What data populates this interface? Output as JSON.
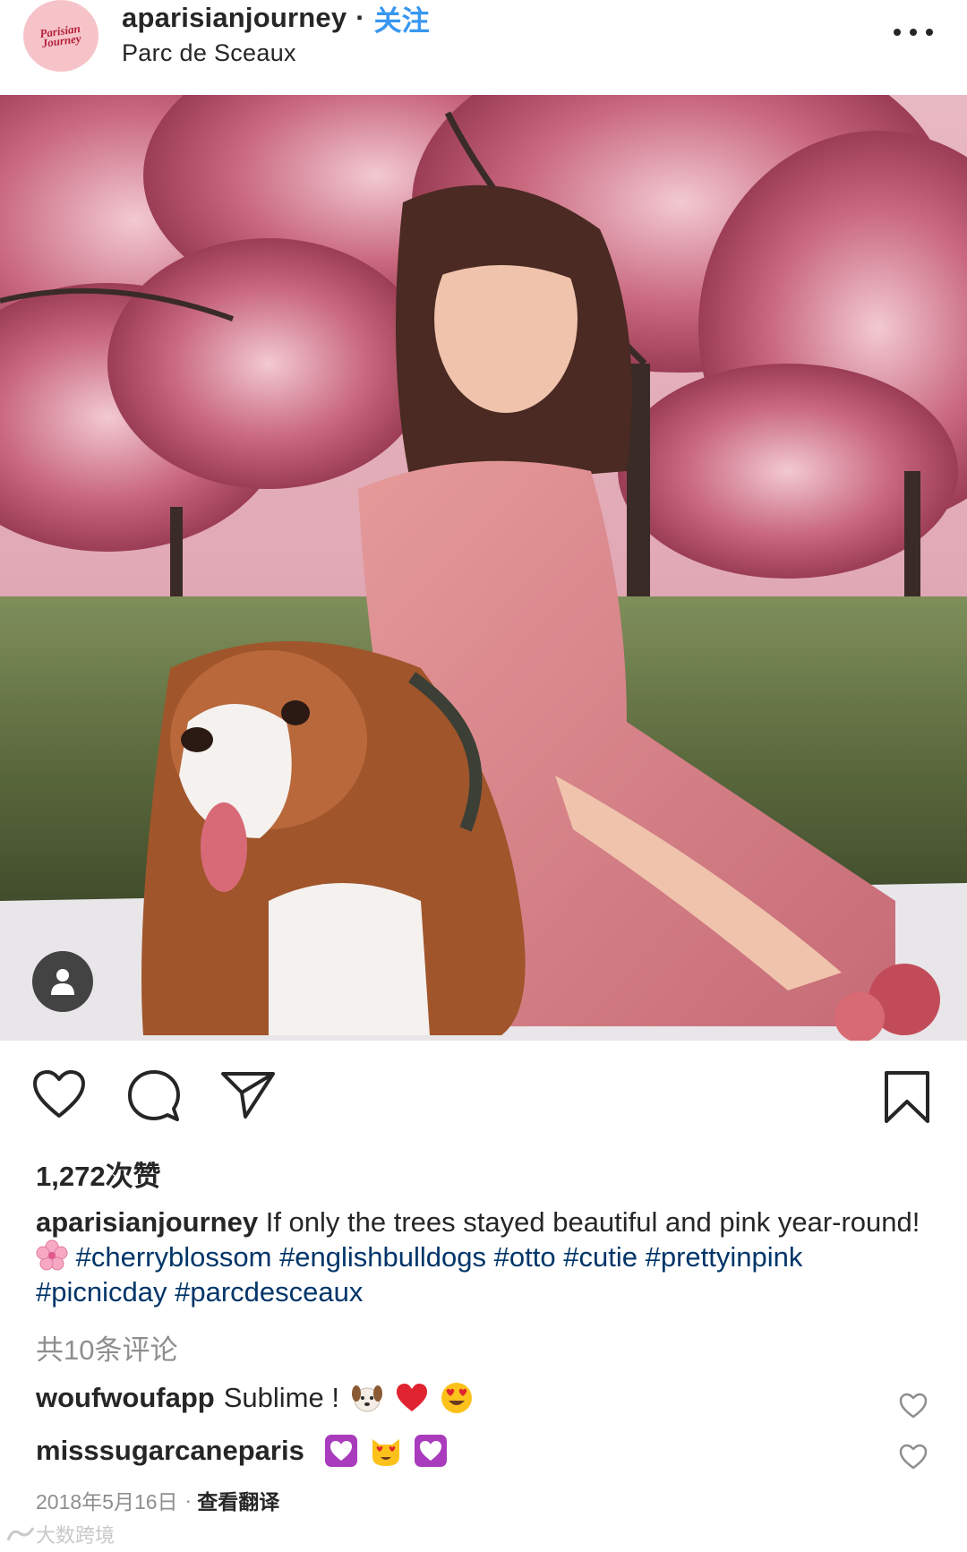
{
  "header": {
    "avatar_text_line1": "Parisian",
    "avatar_text_line2": "Journey",
    "username": "aparisianjourney",
    "separator": "·",
    "follow_label": "关注",
    "location": "Parc de Sceaux"
  },
  "post": {
    "likes": "1,272次赞",
    "caption_user": "aparisianjourney",
    "caption_text_1": " If only the trees stayed beautiful and pink year-round! ",
    "hashtags": [
      "#cherryblossom",
      "#englishbulldogs",
      "#otto",
      "#cutie",
      "#prettyinpink",
      "#picnicday",
      "#parcdesceaux"
    ],
    "view_comments": "共10条评论",
    "comments": [
      {
        "user": "woufwoufapp",
        "text": "Sublime !",
        "emojis": [
          "dog-face",
          "red-heart",
          "heart-eyes"
        ]
      },
      {
        "user": "misssugarcaneparis",
        "text": "",
        "emojis": [
          "purple-heart",
          "heart-eyes-cat",
          "purple-heart"
        ]
      }
    ],
    "date": "2018年5月16日",
    "dot": "·",
    "translate_label": "查看翻译"
  },
  "watermark": "大数跨境",
  "colors": {
    "follow_blue": "#3897f0",
    "hashtag_navy": "#003569",
    "muted_gray": "#8e8e8e",
    "text": "#262626"
  }
}
